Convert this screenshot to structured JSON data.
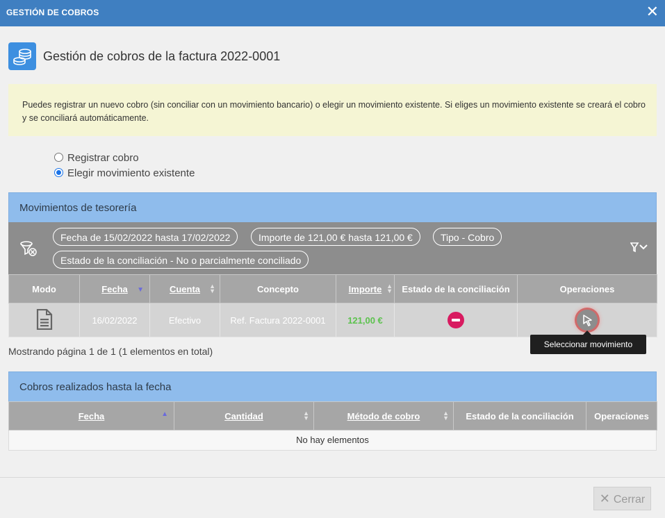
{
  "window": {
    "title": "GESTIÓN DE COBROS",
    "close_glyph": "✕"
  },
  "header": {
    "title": "Gestión de cobros de la factura 2022-0001",
    "icon": "coins-stack-icon"
  },
  "info": {
    "text": "Puedes registrar un nuevo cobro (sin conciliar con un movimiento bancario) o elegir un movimiento existente. Si eliges un movimiento existente se creará el cobro y se conciliará automáticamente."
  },
  "options": [
    {
      "label": "Registrar cobro",
      "selected": false
    },
    {
      "label": "Elegir movimiento existente",
      "selected": true
    }
  ],
  "movimientos": {
    "title": "Movimientos de tesorería",
    "filters": [
      "Fecha de 15/02/2022 hasta 17/02/2022",
      "Importe de 121,00 € hasta 121,00 €",
      "Tipo - Cobro",
      "Estado de la conciliación - No o parcialmente conciliado"
    ],
    "columns": [
      "Modo",
      "Fecha",
      "Cuenta",
      "Concepto",
      "Importe",
      "Estado de la conciliación",
      "Operaciones"
    ],
    "rows": [
      {
        "modo_icon": "document-icon",
        "fecha": "16/02/2022",
        "cuenta": "Efectivo",
        "concepto": "Ref. Factura 2022-0001",
        "importe": "121,00 €",
        "estado_icon": "minus-circle-icon"
      }
    ],
    "tooltip": "Seleccionar movimiento",
    "pager": "Mostrando página 1 de 1 (1 elementos en total)"
  },
  "cobros": {
    "title": "Cobros realizados hasta la fecha",
    "columns": [
      "Fecha",
      "Cantidad",
      "Método de cobro",
      "Estado de la conciliación",
      "Operaciones"
    ],
    "empty": "No hay elementos"
  },
  "footer": {
    "close_label": "Cerrar"
  },
  "colors": {
    "titlebar": "#3f7fc1",
    "panel_head": "#8fbcec",
    "info_bg": "#f5f5d4",
    "amount": "#5cc24e",
    "status_red": "#d81b60"
  }
}
